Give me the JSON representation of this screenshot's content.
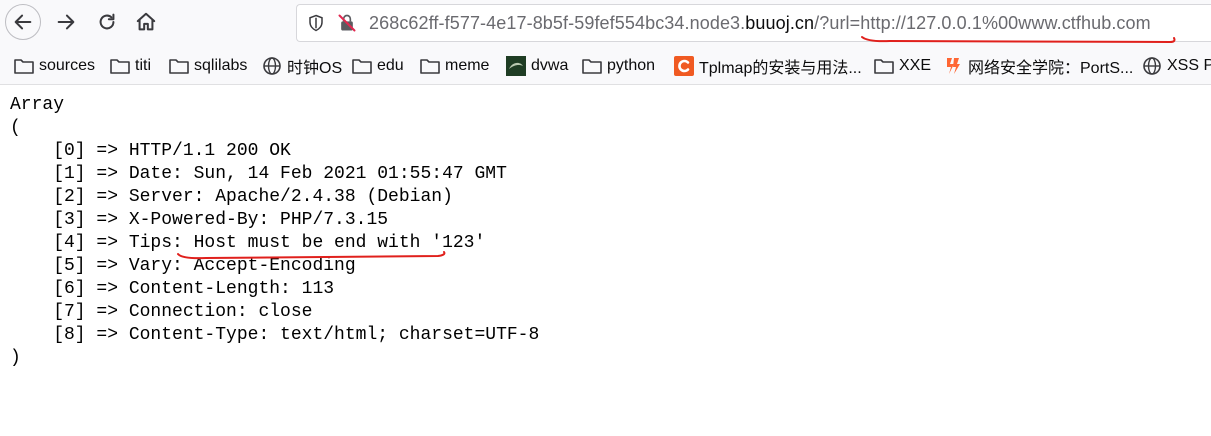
{
  "url": {
    "subdomain": "268c62ff-f577-4e17-8b5f-59fef554bc34.node3.",
    "domain": "buuoj.cn",
    "path": "/?url=http://127.0.0.1%00www.ctfhub.com"
  },
  "bookmarks": [
    {
      "label": "sources",
      "icon": "folder-icon"
    },
    {
      "label": "titi",
      "icon": "folder-icon"
    },
    {
      "label": "sqlilabs",
      "icon": "folder-icon"
    },
    {
      "label": "时钟OS",
      "icon": "globe-icon"
    },
    {
      "label": "edu",
      "icon": "folder-icon"
    },
    {
      "label": "meme",
      "icon": "folder-icon"
    },
    {
      "label": "dvwa",
      "icon": "dvwa-icon"
    },
    {
      "label": "python",
      "icon": "folder-icon"
    },
    {
      "label": "Tplmap的安装与用法...",
      "icon": "c-logo-icon"
    },
    {
      "label": "XXE",
      "icon": "folder-icon"
    },
    {
      "label": "网络安全学院：PortS...",
      "icon": "portswigger-icon"
    },
    {
      "label": "XSS Pl",
      "icon": "globe-icon"
    }
  ],
  "output": {
    "open": "Array",
    "paren_open": "(",
    "lines": [
      "    [0] => HTTP/1.1 200 OK",
      "    [1] => Date: Sun, 14 Feb 2021 01:55:47 GMT",
      "    [2] => Server: Apache/2.4.38 (Debian)",
      "    [3] => X-Powered-By: PHP/7.3.15",
      "    [4] => Tips: Host must be end with '123'",
      "    [5] => Vary: Accept-Encoding",
      "    [6] => Content-Length: 113",
      "    [7] => Connection: close",
      "    [8] => Content-Type: text/html; charset=UTF-8"
    ],
    "paren_close": ")"
  },
  "colors": {
    "annotation": "#e0201c",
    "dvwa": "#1f3d24",
    "c_logo": "#f05a22",
    "portswigger": "#ff6633"
  }
}
